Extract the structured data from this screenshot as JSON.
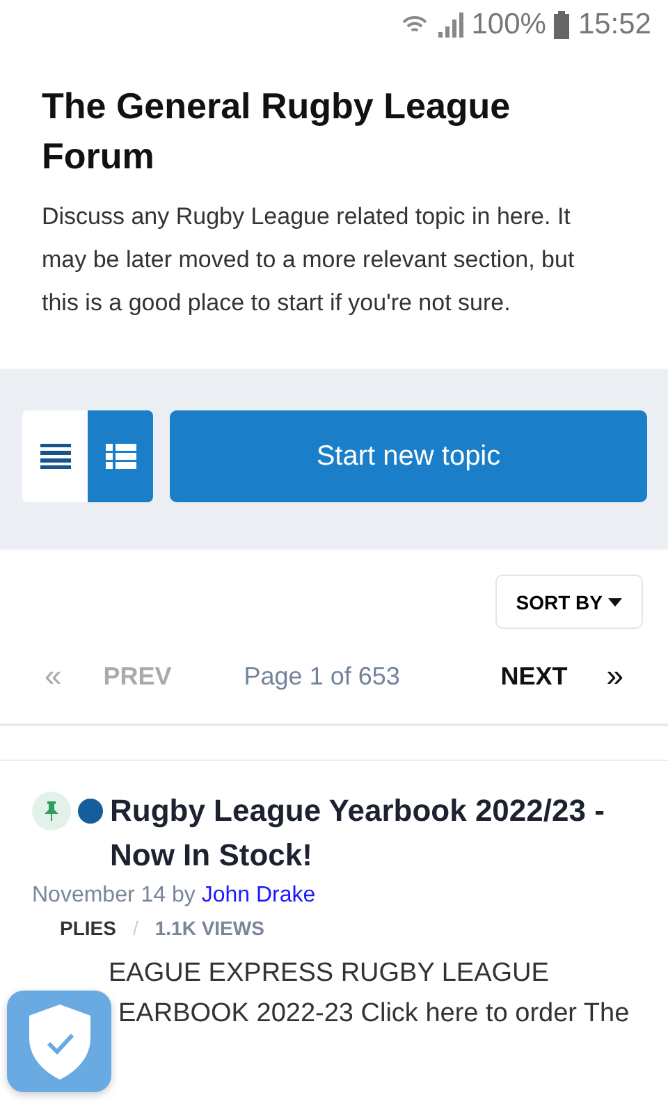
{
  "status_bar": {
    "battery": "100%",
    "time": "15:52"
  },
  "forum": {
    "title": "The General Rugby League Forum",
    "description": "Discuss any Rugby League related topic in here. It may be later moved to a more relevant section, but this is a good place to start if you're not sure."
  },
  "view_toggle": [
    {
      "kind": "list",
      "selected": false
    },
    {
      "kind": "grid",
      "selected": true
    }
  ],
  "start_button": "Start new topic",
  "sort": {
    "label": "SORT BY"
  },
  "pagination": {
    "first": "«",
    "prev": "PREV",
    "page": "Page 1 of 653",
    "next": "NEXT",
    "last": "»"
  },
  "topics": [
    {
      "pinned": true,
      "unread": true,
      "title": "Rugby League Yearbook 2022/23 - Now In Stock!",
      "date": "November 14",
      "by": "by",
      "author": "John Drake",
      "replies": "PLIES",
      "separator": "/",
      "views": "1.1K VIEWS",
      "excerpt": [
        "EAGUE EXPRESS RUGBY LEAGUE",
        "EARBOOK 2022-23 Click here to order The"
      ]
    }
  ]
}
